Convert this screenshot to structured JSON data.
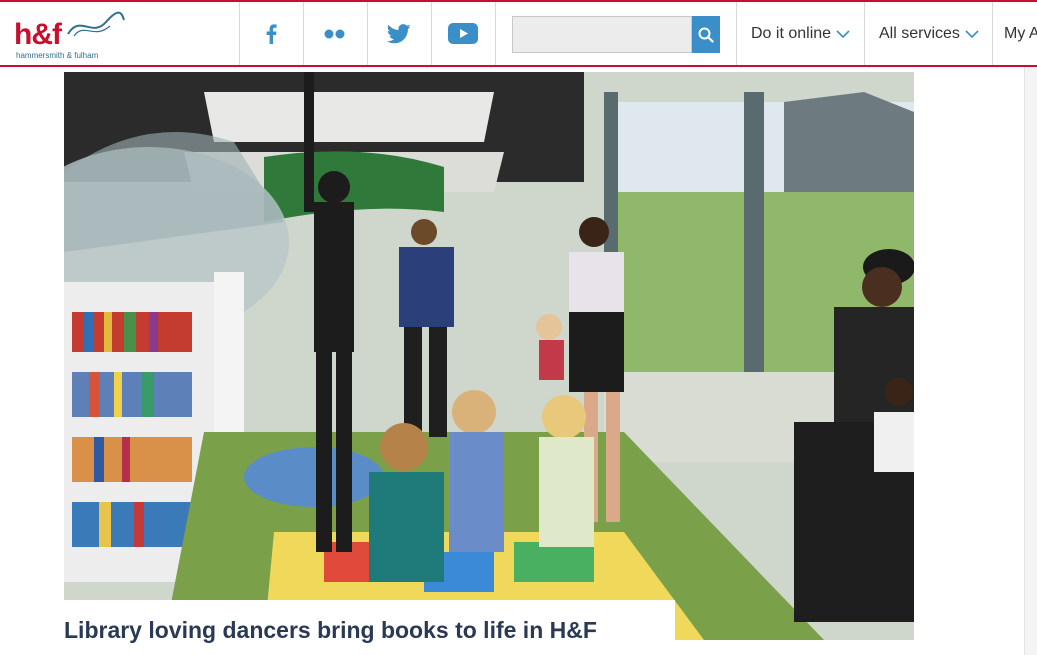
{
  "brand": {
    "logo_text": "h&f",
    "logo_subtext": "hammersmith & fulham",
    "accent_color": "#c8102e",
    "link_color": "#3a8fc8"
  },
  "social": [
    {
      "icon": "facebook-icon"
    },
    {
      "icon": "flickr-icon"
    },
    {
      "icon": "twitter-icon"
    },
    {
      "icon": "youtube-icon"
    }
  ],
  "search": {
    "value": "",
    "placeholder": "",
    "button_icon": "search-icon"
  },
  "nav": {
    "do_it_online": "Do it online",
    "all_services": "All services",
    "my_account": "My A"
  },
  "article": {
    "headline": "Library loving dancers bring books to life in H&F"
  }
}
